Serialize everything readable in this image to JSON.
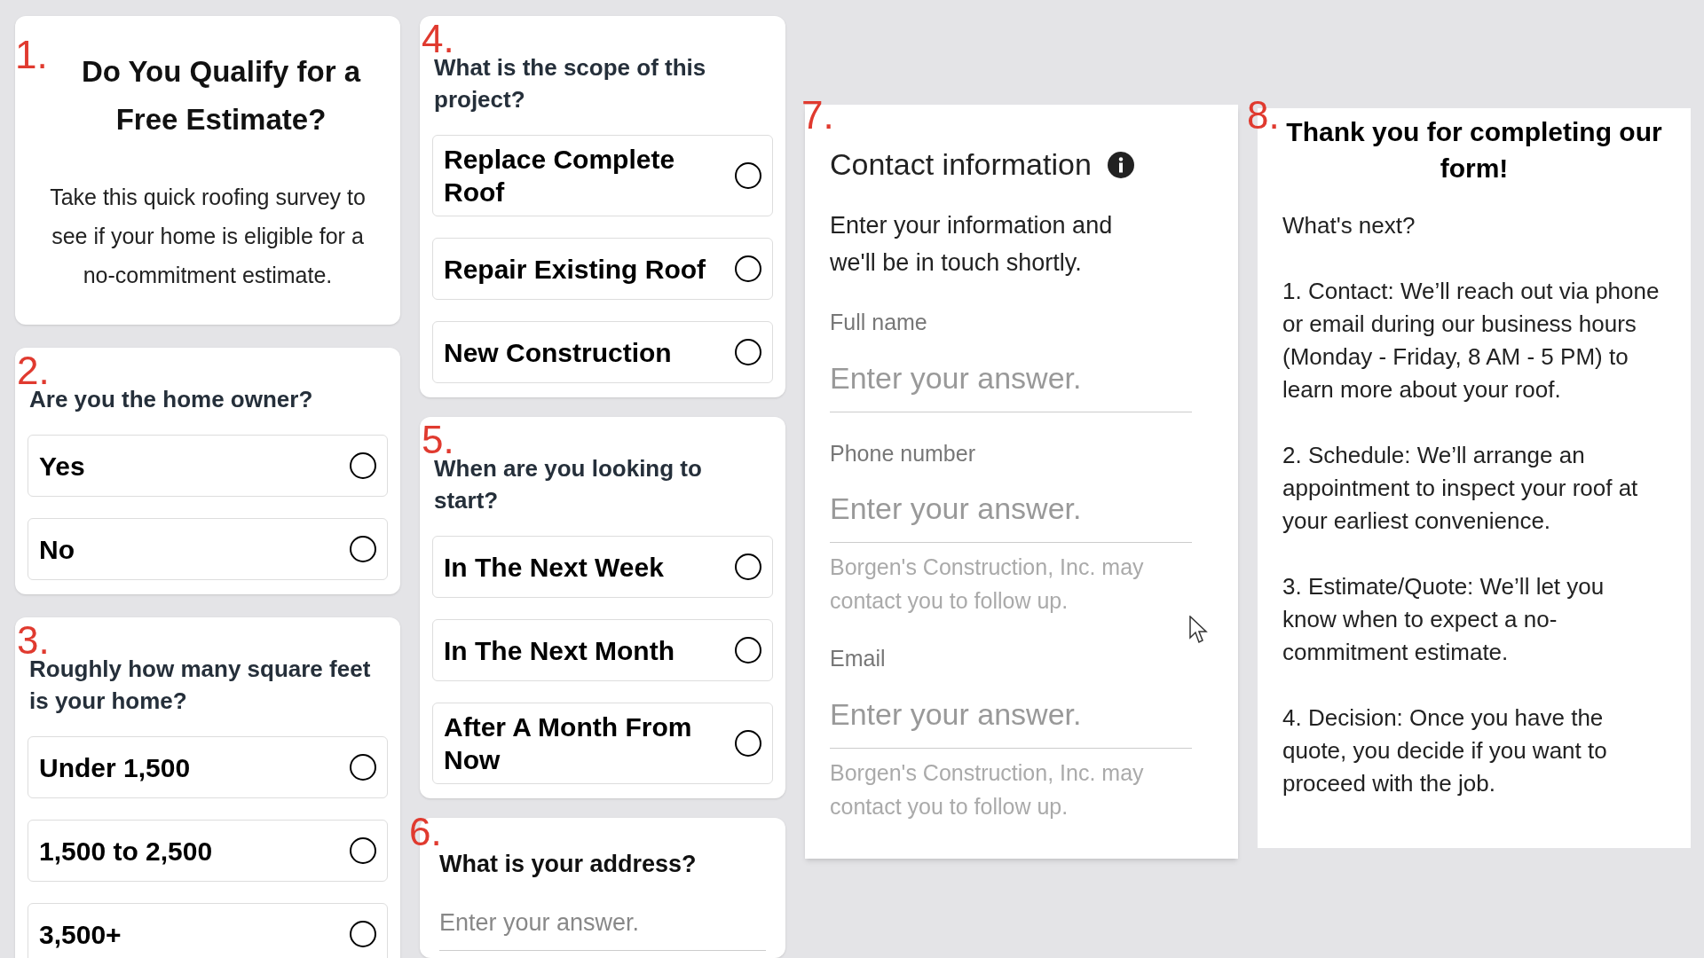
{
  "columns": [
    {
      "panels": [
        {
          "kind": "intro",
          "number": "1.",
          "title": "Do You Qualify for a Free Estimate?",
          "text": "Take this quick roofing survey to see if your home is eligible for a no-commitment estimate."
        },
        {
          "kind": "choice",
          "number": "2.",
          "question": "Are you the home owner?",
          "options": [
            {
              "label": "Yes",
              "selected": false
            },
            {
              "label": "No",
              "selected": false
            }
          ]
        },
        {
          "kind": "choice",
          "number": "3.",
          "question": "Roughly how many square feet is your home?",
          "options": [
            {
              "label": "Under 1,500",
              "selected": false
            },
            {
              "label": "1,500 to 2,500",
              "selected": false
            },
            {
              "label": "3,500+",
              "selected": false
            }
          ]
        }
      ]
    },
    {
      "panels": [
        {
          "kind": "choice",
          "number": "4.",
          "question": "What is the scope of this project?",
          "options": [
            {
              "label": "Replace Complete Roof",
              "selected": false
            },
            {
              "label": "Repair Existing Roof",
              "selected": false
            },
            {
              "label": "New Construction",
              "selected": false
            }
          ]
        },
        {
          "kind": "choice",
          "number": "5.",
          "question": "When are you looking to start?",
          "options": [
            {
              "label": "In The Next Week",
              "selected": false
            },
            {
              "label": "In The Next Month",
              "selected": false
            },
            {
              "label": "After A Month From Now",
              "selected": false
            }
          ]
        },
        {
          "kind": "address",
          "number": "6.",
          "question": "What is your address?",
          "placeholder": "Enter your answer."
        }
      ]
    },
    {
      "panels": [
        {
          "kind": "contact",
          "number": "7.",
          "title": "Contact information",
          "text": "Enter your information and we'll be in touch shortly.",
          "fields": [
            {
              "label": "Full name",
              "placeholder": "Enter your answer."
            },
            {
              "label": "Phone number",
              "placeholder": "Enter your answer.",
              "note": "Borgen's Construction, Inc. may contact you to follow up."
            },
            {
              "label": "Email",
              "placeholder": "Enter your answer.",
              "note": "Borgen's Construction, Inc. may contact you to follow up."
            }
          ]
        }
      ]
    },
    {
      "panels": [
        {
          "kind": "thanks",
          "number": "8.",
          "title": "Thank you for completing our form!",
          "paragraphs": [
            "What's next?",
            "1. Contact: We’ll reach out via phone or email during our business hours (Monday - Friday, 8 AM - 5 PM) to learn more about your roof.",
            "2. Schedule: We’ll arrange an appointment to inspect your roof at your earliest convenience.",
            "3. Estimate/Quote: We’ll let you know when to expect a no-commitment estimate.",
            "4. Decision: Once you have the quote, you decide if you want to proceed with the job."
          ]
        }
      ]
    }
  ]
}
